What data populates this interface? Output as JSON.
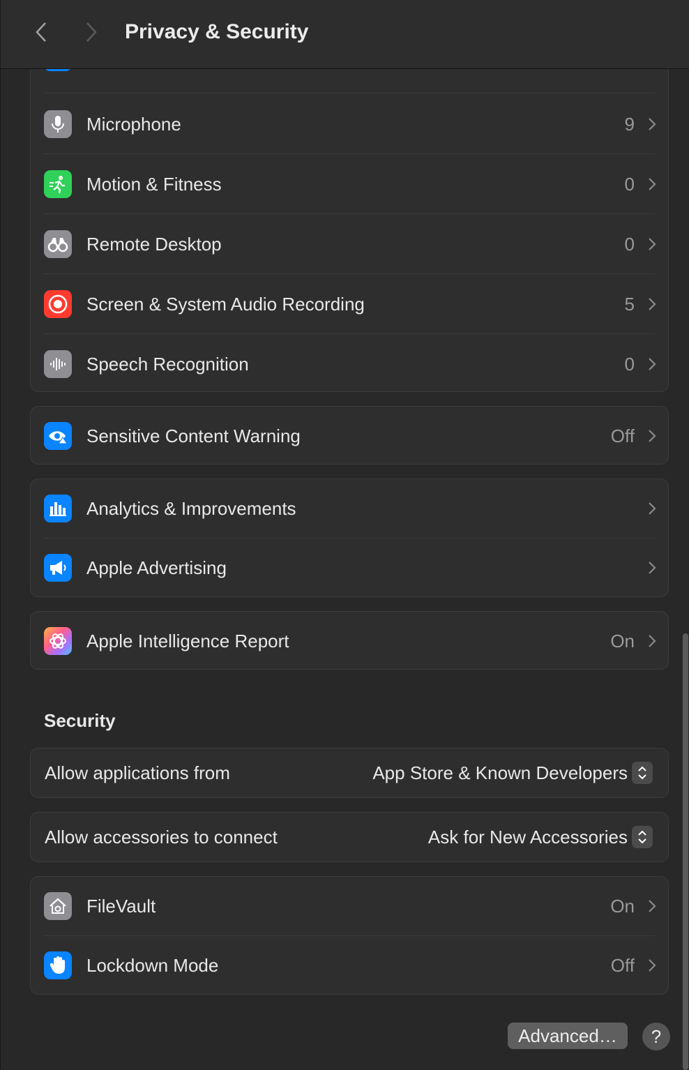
{
  "window": {
    "title": "Privacy & Security"
  },
  "privacy_list": [
    {
      "label": "Microphone",
      "value": "9",
      "icon": "microphone-icon",
      "color": "#8e8e93"
    },
    {
      "label": "Motion & Fitness",
      "value": "0",
      "icon": "fitness-icon",
      "color": "#30d158"
    },
    {
      "label": "Remote Desktop",
      "value": "0",
      "icon": "binoculars-icon",
      "color": "#8e8e93"
    },
    {
      "label": "Screen & System Audio Recording",
      "value": "5",
      "icon": "record-icon",
      "color": "#ff3b30"
    },
    {
      "label": "Speech Recognition",
      "value": "0",
      "icon": "waveform-icon",
      "color": "#8e8e93"
    }
  ],
  "sensitive": {
    "label": "Sensitive Content Warning",
    "value": "Off",
    "icon": "eye-warning-icon",
    "color": "#0a84ff"
  },
  "analytics_group": [
    {
      "label": "Analytics & Improvements",
      "icon": "bar-chart-icon",
      "color": "#0a84ff"
    },
    {
      "label": "Apple Advertising",
      "icon": "megaphone-icon",
      "color": "#0a84ff"
    }
  ],
  "intelligence": {
    "label": "Apple Intelligence Report",
    "value": "On",
    "icon": "apple-intelligence-icon"
  },
  "security": {
    "title": "Security",
    "allow_apps": {
      "label": "Allow applications from",
      "value": "App Store & Known Developers"
    },
    "allow_accessories": {
      "label": "Allow accessories to connect",
      "value": "Ask for New Accessories"
    },
    "items": [
      {
        "label": "FileVault",
        "value": "On",
        "icon": "filevault-house-icon",
        "color": "#8e8e93"
      },
      {
        "label": "Lockdown Mode",
        "value": "Off",
        "icon": "hand-icon",
        "color": "#0a84ff"
      }
    ]
  },
  "footer": {
    "advanced_label": "Advanced…",
    "help_label": "?"
  }
}
